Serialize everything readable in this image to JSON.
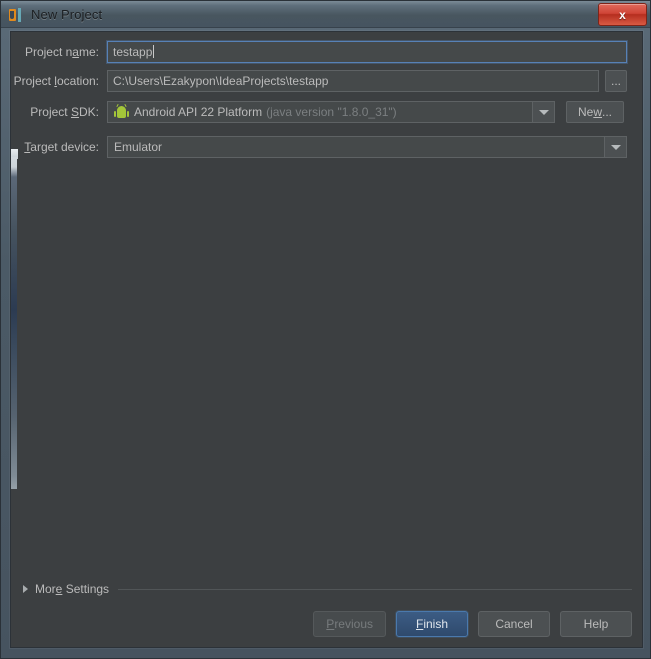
{
  "window": {
    "title": "New Project",
    "app_icon": "intellij-idea-icon",
    "close_label": "x"
  },
  "form": {
    "project_name": {
      "label_pre": "Project n",
      "label_mnemonic": "a",
      "label_post": "me:",
      "value": "testapp",
      "placeholder": "",
      "focused": true
    },
    "project_location": {
      "label_pre": "Project ",
      "label_mnemonic": "l",
      "label_post": "ocation:",
      "value": "C:\\Users\\Ezakypon\\IdeaProjects\\testapp",
      "placeholder": "",
      "browse_label": "..."
    },
    "project_sdk": {
      "label_pre": "Project ",
      "label_mnemonic": "S",
      "label_post": "DK:",
      "value": "Android API 22 Platform",
      "value_sub": "(java version \"1.8.0_31\")",
      "icon": "android-icon",
      "new_button_pre": "Ne",
      "new_button_mnemonic": "w",
      "new_button_post": "..."
    },
    "target_device": {
      "label_pre": "",
      "label_mnemonic": "T",
      "label_post": "arget device:",
      "value": "Emulator"
    }
  },
  "more_settings": {
    "label_pre": "Mor",
    "label_mnemonic": "e",
    "label_post": " Settings",
    "expanded": false
  },
  "buttons": {
    "previous": {
      "pre": "",
      "mnemonic": "P",
      "post": "revious",
      "disabled": true
    },
    "finish": {
      "pre": "",
      "mnemonic": "F",
      "post": "inish",
      "default": true
    },
    "cancel": {
      "pre": "Cancel",
      "mnemonic": "",
      "post": ""
    },
    "help": {
      "pre": "Help",
      "mnemonic": "",
      "post": ""
    }
  },
  "colors": {
    "dialog_bg": "#3c3f41",
    "field_bg": "#45494a",
    "border": "#5e6264",
    "text": "#bbbbbb",
    "muted_text": "#7b7f81",
    "accent_focus": "#5781b6",
    "default_button": "#2f4a6d",
    "android_green": "#a4c639",
    "close_red": "#cf4436",
    "titlebar_top": "#7b8b97"
  }
}
